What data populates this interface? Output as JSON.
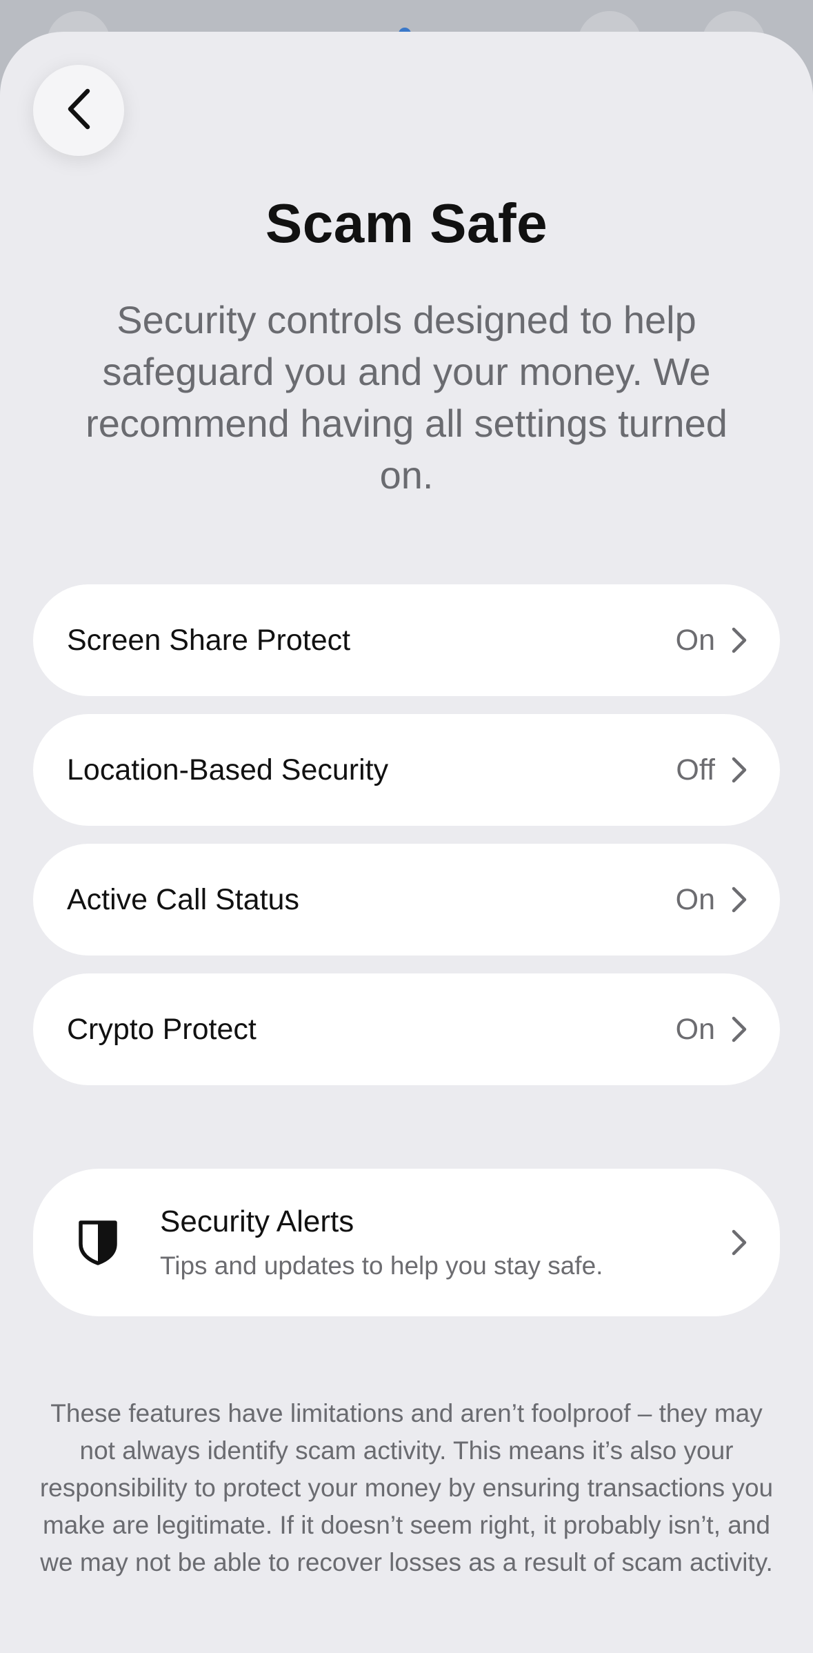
{
  "title": "Scam Safe",
  "intro": "Security controls designed to help safeguard you and your money. We recommend having all settings turned on.",
  "settings": [
    {
      "label": "Screen Share Protect",
      "value": "On"
    },
    {
      "label": "Location-Based Security",
      "value": "Off"
    },
    {
      "label": "Active Call Status",
      "value": "On"
    },
    {
      "label": "Crypto Protect",
      "value": "On"
    }
  ],
  "alerts": {
    "title": "Security Alerts",
    "subtitle": "Tips and updates to help you stay safe.",
    "icon": "shield-icon"
  },
  "disclaimer": "These features have limitations and aren’t foolproof – they may not always identify scam activity. This means it’s also your responsibility to protect your money by ensuring transactions you make are legitimate. If it doesn’t seem right, it probably isn’t, and we may not be able to recover losses as a result of scam activity.",
  "colors": {
    "sheet_background": "#ebebef",
    "card_background": "#ffffff",
    "secondary_text": "#6c6c70"
  }
}
